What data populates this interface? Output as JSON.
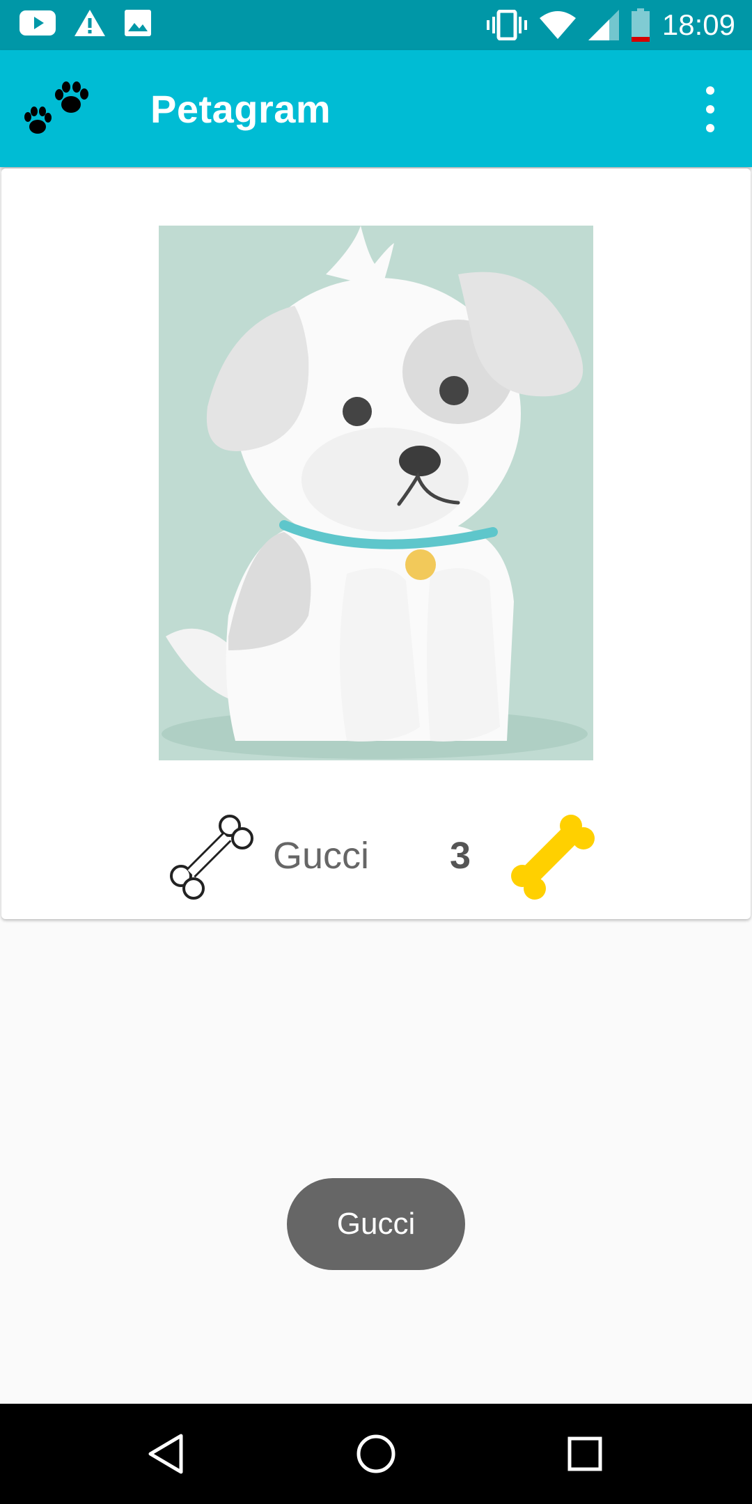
{
  "status_bar": {
    "time": "18:09",
    "left_icons": [
      "youtube-icon",
      "warning-icon",
      "image-icon"
    ],
    "right_icons": [
      "vibrate-icon",
      "wifi-icon",
      "signal-icon",
      "battery-low-icon"
    ],
    "battery_color": "#d50000"
  },
  "app_bar": {
    "title": "Petagram",
    "logo": "paw-prints-icon",
    "menu": "overflow-menu-icon",
    "color": "#00bcd4"
  },
  "card": {
    "photo": "puppy-illustration",
    "pet_name": "Gucci",
    "likes": "3",
    "like_icon": "bone-outline-icon",
    "rating_icon": "bone-gold-icon",
    "rating_color": "#ffd000"
  },
  "toast": {
    "text": "Gucci"
  },
  "nav_bar": {
    "buttons": [
      "back-icon",
      "home-icon",
      "recents-icon"
    ]
  }
}
